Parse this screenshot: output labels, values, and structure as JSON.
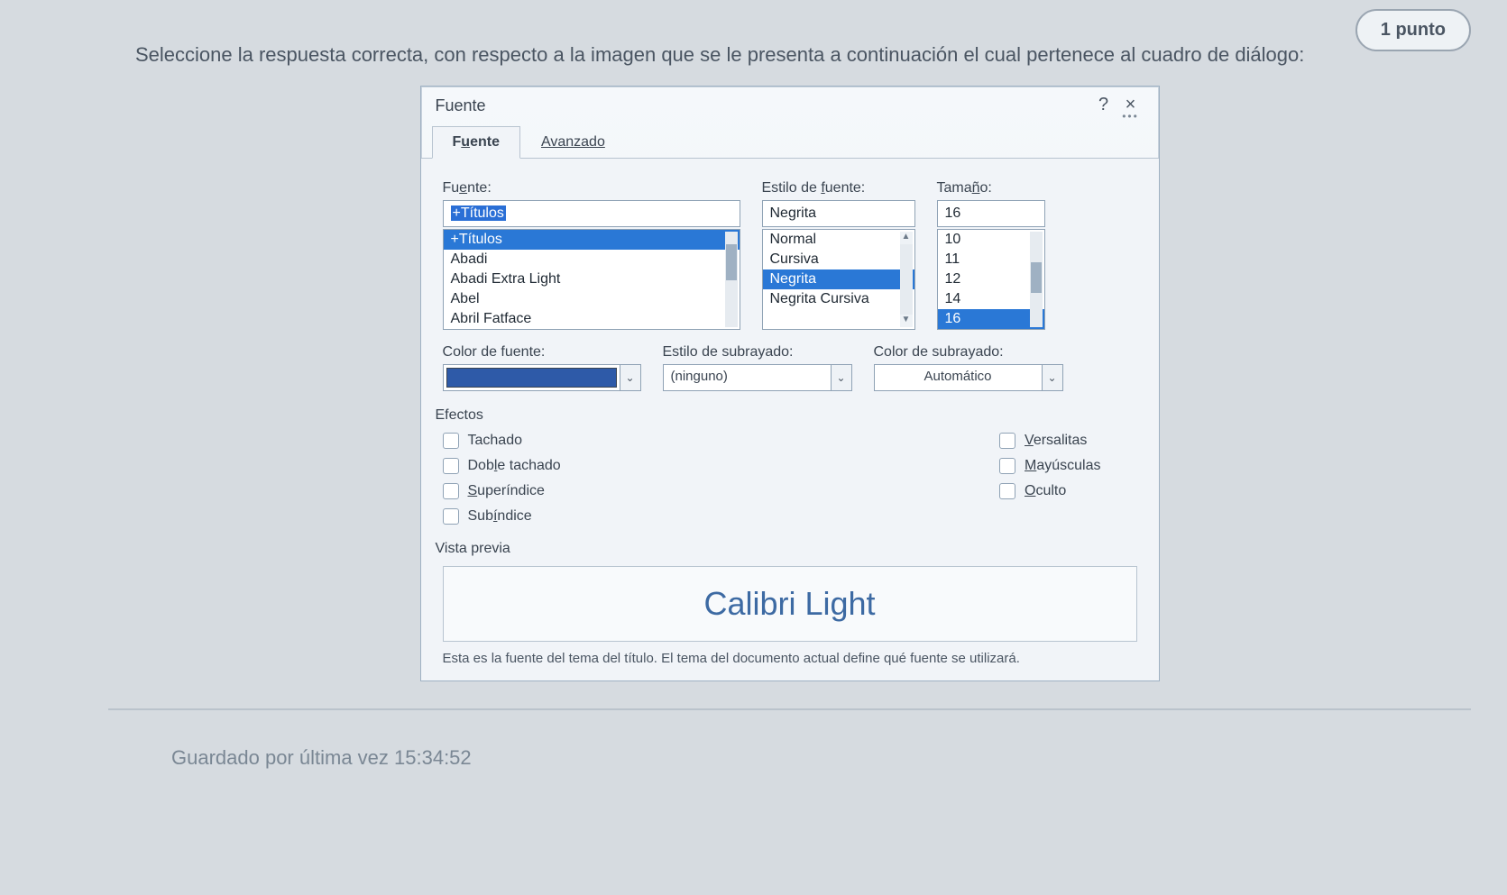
{
  "page": {
    "points_label": "1 punto",
    "question_text": "Seleccione la respuesta correcta, con respecto a la imagen que se le presenta a continuación el cual pertenece al cuadro de diálogo:",
    "saved_footer": "Guardado por última vez 15:34:52"
  },
  "dialog": {
    "title": "Fuente",
    "help_symbol": "?",
    "close_symbol": "×",
    "tabs": {
      "font": "Fuente",
      "advanced": "Avanzado"
    },
    "font_section": {
      "label": "Fuente:",
      "value": "+Títulos",
      "options": [
        "+Títulos",
        "Abadi",
        "Abadi Extra Light",
        "Abel",
        "Abril Fatface"
      ]
    },
    "style_section": {
      "label": "Estilo de fuente:",
      "value": "Negrita",
      "options": [
        "Normal",
        "Cursiva",
        "Negrita",
        "Negrita Cursiva"
      ]
    },
    "size_section": {
      "label": "Tamaño:",
      "value": "16",
      "options": [
        "10",
        "11",
        "12",
        "14",
        "16"
      ]
    },
    "color_section": {
      "label": "Color de fuente:"
    },
    "underline_style": {
      "label": "Estilo de subrayado:",
      "value": "(ninguno)"
    },
    "underline_color": {
      "label": "Color de subrayado:",
      "value": "Automático"
    },
    "effects": {
      "title": "Efectos",
      "left": [
        "Tachado",
        "Doble tachado",
        "Superíndice",
        "Subíndice"
      ],
      "right": [
        "Versalitas",
        "Mayúsculas",
        "Oculto"
      ]
    },
    "preview": {
      "title": "Vista previa",
      "sample": "Calibri Light",
      "note": "Esta es la fuente del tema del título. El tema del documento actual define qué fuente se utilizará."
    }
  }
}
